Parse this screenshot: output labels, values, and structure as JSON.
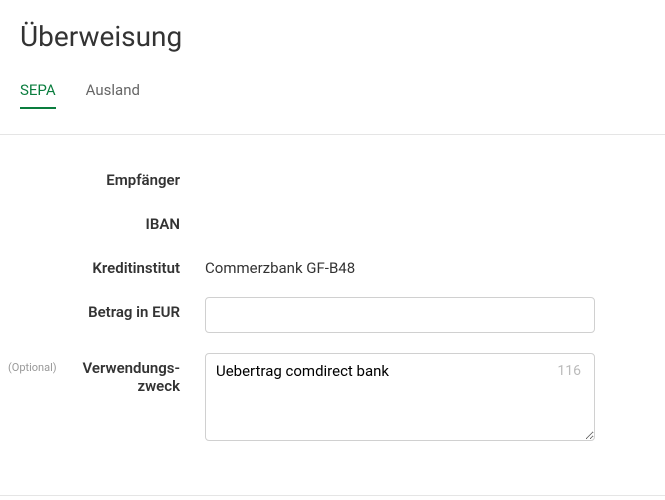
{
  "title": "Überweisung",
  "tabs": {
    "sepa": "SEPA",
    "ausland": "Ausland"
  },
  "form": {
    "optional": "(Optional)",
    "recipient": {
      "label": "Empfänger"
    },
    "iban": {
      "label": "IBAN"
    },
    "bank": {
      "label": "Kreditinstitut",
      "value": "Commerzbank GF-B48"
    },
    "amount": {
      "label": "Betrag in EUR",
      "value": ""
    },
    "purpose": {
      "label": "Verwendungs-zweck",
      "value": "Uebertrag comdirect bank",
      "remaining": "116"
    }
  }
}
